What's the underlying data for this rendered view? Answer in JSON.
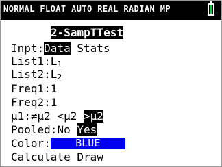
{
  "status_bar": {
    "text": "NORMAL FLOAT AUTO REAL RADIAN MP",
    "battery_icon": "battery-icon",
    "battery_color": "#2db84d"
  },
  "title": "2-SampTTest",
  "input": {
    "label": "Inpt:",
    "options": [
      "Data",
      "Stats"
    ],
    "selected": "Data"
  },
  "list1": {
    "label": "List1:",
    "value": "L",
    "sub": "1"
  },
  "list2": {
    "label": "List2:",
    "value": "L",
    "sub": "2"
  },
  "freq1": {
    "label": "Freq1:",
    "value": "1"
  },
  "freq2": {
    "label": "Freq2:",
    "value": "1"
  },
  "alternative": {
    "label": "μ1:",
    "options": [
      "≠μ2",
      "<μ2",
      ">μ2"
    ],
    "selected": ">μ2"
  },
  "pooled": {
    "label": "Pooled:",
    "options": [
      "No",
      "Yes"
    ],
    "selected": "Yes"
  },
  "color": {
    "label": "Color:",
    "value": "BLUE",
    "swatch": "#0000ee"
  },
  "actions": {
    "calculate": "Calculate",
    "draw": "Draw"
  }
}
